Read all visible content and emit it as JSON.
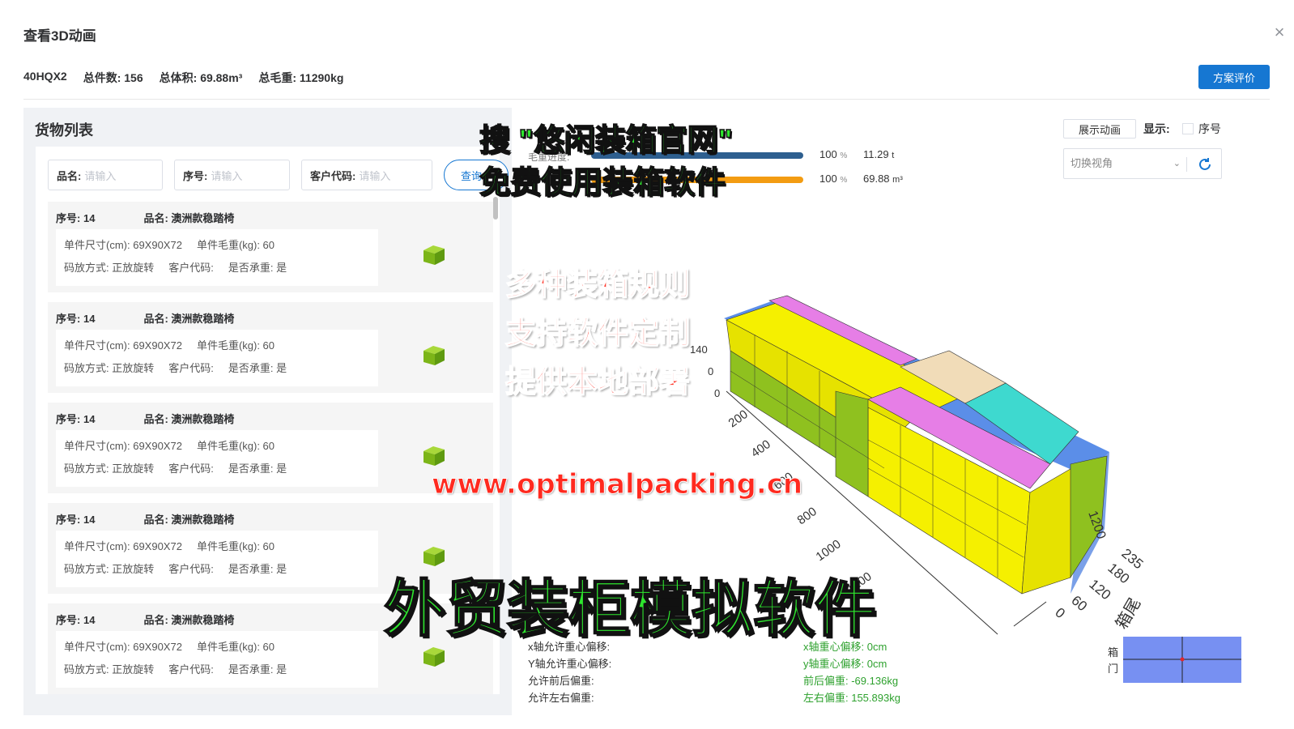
{
  "dialog": {
    "title": "查看3D动画",
    "close_glyph": "×"
  },
  "summary": {
    "container": "40HQX2",
    "total_pieces_label": "总件数:",
    "total_pieces": "156",
    "total_volume_label": "总体积:",
    "total_volume": "69.88m³",
    "total_weight_label": "总毛重:",
    "total_weight": "11290kg"
  },
  "eval_button": "方案评价",
  "cargo_list": {
    "title": "货物列表",
    "filters": [
      {
        "label": "品名:",
        "placeholder": "请输入"
      },
      {
        "label": "序号:",
        "placeholder": "请输入"
      },
      {
        "label": "客户代码:",
        "placeholder": "请输入"
      }
    ],
    "query_button": "查询",
    "items": [
      {
        "seq_label": "序号:",
        "seq": "14",
        "name_label": "品名:",
        "name": "澳洲款稳踏椅",
        "size": "单件尺寸(cm): 69X90X72",
        "weight": "单件毛重(kg): 60",
        "stack": "码放方式: 正放旋转",
        "customer": "客户代码:",
        "bearing": "是否承重: 是"
      },
      {
        "seq_label": "序号:",
        "seq": "14",
        "name_label": "品名:",
        "name": "澳洲款稳踏椅",
        "size": "单件尺寸(cm): 69X90X72",
        "weight": "单件毛重(kg): 60",
        "stack": "码放方式: 正放旋转",
        "customer": "客户代码:",
        "bearing": "是否承重: 是"
      },
      {
        "seq_label": "序号:",
        "seq": "14",
        "name_label": "品名:",
        "name": "澳洲款稳踏椅",
        "size": "单件尺寸(cm): 69X90X72",
        "weight": "单件毛重(kg): 60",
        "stack": "码放方式: 正放旋转",
        "customer": "客户代码:",
        "bearing": "是否承重: 是"
      },
      {
        "seq_label": "序号:",
        "seq": "14",
        "name_label": "品名:",
        "name": "澳洲款稳踏椅",
        "size": "单件尺寸(cm): 69X90X72",
        "weight": "单件毛重(kg): 60",
        "stack": "码放方式: 正放旋转",
        "customer": "客户代码:",
        "bearing": "是否承重: 是"
      },
      {
        "seq_label": "序号:",
        "seq": "14",
        "name_label": "品名:",
        "name": "澳洲款稳踏椅",
        "size": "单件尺寸(cm): 69X90X72",
        "weight": "单件毛重(kg): 60",
        "stack": "码放方式: 正放旋转",
        "customer": "客户代码:",
        "bearing": "是否承重: 是"
      }
    ]
  },
  "progress": {
    "weight_label": "毛重进度:",
    "weight_pct": "100",
    "weight_pct_unit": "%",
    "weight_value": "11.29",
    "weight_unit": "t",
    "volume_pct": "100",
    "volume_pct_unit": "%",
    "volume_value": "69.88",
    "volume_unit": "m³",
    "weight_fill": 1.0,
    "volume_fill": 1.0,
    "weight_color": "#2e5f8f",
    "volume_color": "#f39c12"
  },
  "controls": {
    "show_animation": "展示动画",
    "display_label": "显示:",
    "seq_checkbox": "序号",
    "view_select": "切换视角",
    "chevron": "⌄"
  },
  "axis": {
    "length_ticks": [
      "200",
      "400",
      "600",
      "800",
      "1000",
      "1200"
    ],
    "width_ticks": [
      "0",
      "60",
      "120",
      "180",
      "235"
    ],
    "height_ticks": [
      "140",
      "0",
      "0"
    ],
    "extra": "1200",
    "tail_label": "箱尾"
  },
  "stats": {
    "x_allow": "x轴允许重心偏移:",
    "y_allow": "Y轴允许重心偏移:",
    "fb_allow": "允许前后偏重:",
    "lr_allow": "允许左右偏重:",
    "x_offset": "x轴重心偏移: 0cm",
    "y_offset": "y轴重心偏移: 0cm",
    "fb_weight": "前后偏重: -69.136kg",
    "lr_weight": "左右偏重: 155.893kg"
  },
  "minimap": {
    "door_label": "箱门",
    "color": "#7790f2"
  },
  "overlays": {
    "search": "搜 \"悠闲装箱官网\"",
    "free": "免费使用装箱软件",
    "rule1": "多种装箱规则",
    "rule2": "支持软件定制",
    "rule3": "提供本地部署",
    "url": "www.optimalpacking.cn",
    "big": "外贸装柜模拟软件"
  }
}
